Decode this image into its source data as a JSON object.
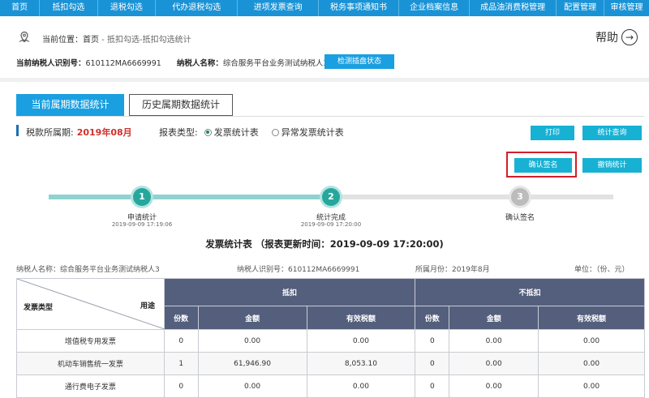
{
  "topnav": {
    "items": [
      "首页",
      "抵扣勾选",
      "退税勾选",
      "代办退税勾选",
      "进项发票查询",
      "税务事项通知书",
      "企业档案信息",
      "成品油消费税管理",
      "配置管理",
      "审核管理"
    ]
  },
  "header": {
    "location_label": "当前位置：",
    "location_home": "首页",
    "location_path": " - 抵扣勾选-抵扣勾选统计",
    "help_label": "帮助",
    "taxpayer_id_label": "当前纳税人识别号：",
    "taxpayer_id_value": "610112MA6669991",
    "taxpayer_name_label": "纳税人名称：",
    "taxpayer_name_value": "综合服务平台业务测试纳税人3",
    "detect_button": "检测插盘状态"
  },
  "tabs": {
    "current": "当前属期数据统计",
    "history": "历史属期数据统计"
  },
  "filters": {
    "period_label": "税款所属期:",
    "period_value": "2019年08月",
    "type_label": "报表类型:",
    "type_options": [
      "发票统计表",
      "异常发票统计表"
    ],
    "type_selected": "发票统计表"
  },
  "actions": {
    "print": "打印",
    "stat_query": "统计查询",
    "confirm_sign": "确认签名",
    "revoke_stat": "撤销统计"
  },
  "steps": [
    {
      "num": "1",
      "label": "申请统计",
      "time": "2019-09-09 17:19:06"
    },
    {
      "num": "2",
      "label": "统计完成",
      "time": "2019-09-09 17:20:00"
    },
    {
      "num": "3",
      "label": "确认签名",
      "time": ""
    }
  ],
  "report": {
    "title": "发票统计表 （报表更新时间：2019-09-09 17:20:00)",
    "meta_taxpayer": "纳税人名称：综合服务平台业务测试纳税人3",
    "meta_id": "纳税人识别号：610112MA6669991",
    "meta_month": "所属月份：2019年8月",
    "meta_unit": "单位：（份、元）",
    "corner_left": "发票类型",
    "corner_right": "用途",
    "group_deduct": "抵扣",
    "group_nondeduct": "不抵扣",
    "cols": [
      "份数",
      "金额",
      "有效税额",
      "份数",
      "金额",
      "有效税额"
    ],
    "rows": [
      {
        "type": "增值税专用发票",
        "values": [
          "0",
          "0.00",
          "0.00",
          "0",
          "0.00",
          "0.00"
        ]
      },
      {
        "type": "机动车销售统一发票",
        "values": [
          "1",
          "61,946.90",
          "8,053.10",
          "0",
          "0.00",
          "0.00"
        ]
      },
      {
        "type": "通行费电子发票",
        "values": [
          "0",
          "0.00",
          "0.00",
          "0",
          "0.00",
          "0.00"
        ]
      }
    ]
  }
}
